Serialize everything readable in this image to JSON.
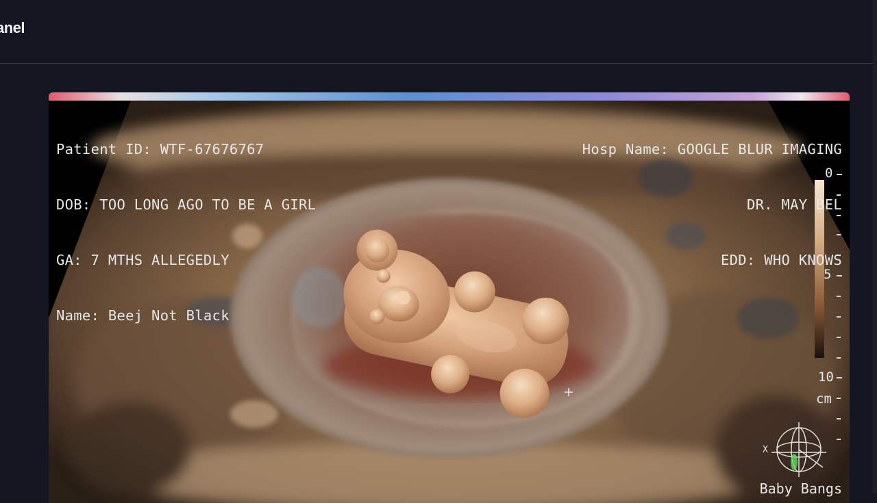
{
  "header": {
    "title": "anel"
  },
  "scan": {
    "top_left": {
      "patient_id": "Patient ID: WTF-67676767",
      "dob": "DOB: TOO LONG AGO TO BE A GIRL",
      "ga": "GA: 7 MTHS ALLEGEDLY",
      "name": "Name: Beej Not Black"
    },
    "top_right": {
      "hospital": "Hosp Name: GOOGLE BLUR IMAGING",
      "doctor": "DR. MAY BEL",
      "edd": "EDD: WHO KNOWS"
    },
    "depth_scale": {
      "top": "0",
      "mid": "5",
      "bottom": "10",
      "unit": "cm"
    },
    "bottom_right": "Baby Bangs",
    "orientation_axis_label": "X",
    "colors": {
      "tissue": "#8a6a48",
      "amniotic": "#6b4a3a",
      "gummy": "#d6a67d"
    }
  }
}
